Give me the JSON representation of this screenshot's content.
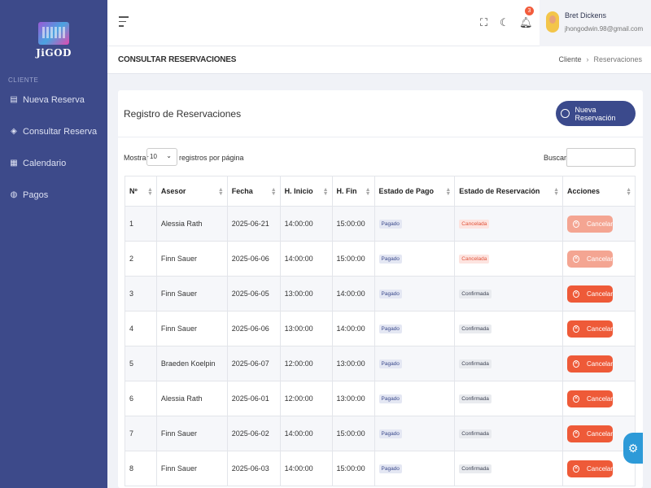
{
  "brand": {
    "name": "JiGOD"
  },
  "sidebar": {
    "section_label": "CLIENTE",
    "items": [
      {
        "label": "Nueva Reserva",
        "icon": "clipboard-icon"
      },
      {
        "label": "Consultar Reserva",
        "icon": "layers-icon"
      },
      {
        "label": "Calendario",
        "icon": "calendar-icon"
      },
      {
        "label": "Pagos",
        "icon": "coins-icon"
      }
    ]
  },
  "topbar": {
    "notification_count": "3",
    "user": {
      "name": "Bret Dickens",
      "email": "jhongodwin.98@gmail.com"
    }
  },
  "breadcrumb": {
    "page_title": "CONSULTAR RESERVACIONES",
    "items": [
      "Cliente",
      "Reservaciones"
    ]
  },
  "card": {
    "title": "Registro de Reservaciones",
    "new_button_label": "Nueva Reservación",
    "show_label": "Mostrar",
    "per_page_value": "10",
    "per_page_suffix": "registros por página",
    "search_label": "Buscar:"
  },
  "table": {
    "headers": [
      "Nº",
      "Asesor",
      "Fecha",
      "H. Inicio",
      "H. Fin",
      "Estado de Pago",
      "Estado de Reservación",
      "Acciones"
    ],
    "action_label": "Cancelar",
    "rows": [
      {
        "n": "1",
        "asesor": "Alessia Rath",
        "fecha": "2025-06-21",
        "inicio": "14:00:00",
        "fin": "15:00:00",
        "pago": "Pagado",
        "estado": "Cancelada",
        "disabled": true
      },
      {
        "n": "2",
        "asesor": "Finn Sauer",
        "fecha": "2025-06-06",
        "inicio": "14:00:00",
        "fin": "15:00:00",
        "pago": "Pagado",
        "estado": "Cancelada",
        "disabled": true
      },
      {
        "n": "3",
        "asesor": "Finn Sauer",
        "fecha": "2025-06-05",
        "inicio": "13:00:00",
        "fin": "14:00:00",
        "pago": "Pagado",
        "estado": "Confirmada",
        "disabled": false
      },
      {
        "n": "4",
        "asesor": "Finn Sauer",
        "fecha": "2025-06-06",
        "inicio": "13:00:00",
        "fin": "14:00:00",
        "pago": "Pagado",
        "estado": "Confirmada",
        "disabled": false
      },
      {
        "n": "5",
        "asesor": "Braeden Koelpin",
        "fecha": "2025-06-07",
        "inicio": "12:00:00",
        "fin": "13:00:00",
        "pago": "Pagado",
        "estado": "Confirmada",
        "disabled": false
      },
      {
        "n": "6",
        "asesor": "Alessia Rath",
        "fecha": "2025-06-01",
        "inicio": "12:00:00",
        "fin": "13:00:00",
        "pago": "Pagado",
        "estado": "Confirmada",
        "disabled": false
      },
      {
        "n": "7",
        "asesor": "Finn Sauer",
        "fecha": "2025-06-02",
        "inicio": "14:00:00",
        "fin": "15:00:00",
        "pago": "Pagado",
        "estado": "Confirmada",
        "disabled": false
      },
      {
        "n": "8",
        "asesor": "Finn Sauer",
        "fecha": "2025-06-03",
        "inicio": "14:00:00",
        "fin": "15:00:00",
        "pago": "Pagado",
        "estado": "Confirmada",
        "disabled": false
      }
    ]
  },
  "colors": {
    "sidebar": "#3d4a8a",
    "primary": "#3b4a8c",
    "danger": "#ee5a38",
    "fab": "#2d9ad8"
  }
}
